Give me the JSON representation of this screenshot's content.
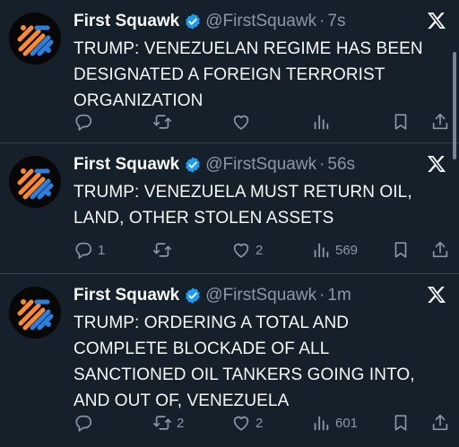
{
  "colors": {
    "background": "#15202b",
    "text": "#f7f9f9",
    "secondary": "#8b98a5",
    "verified": "#1d9bf0",
    "avatar_orange": "#f58a3a",
    "avatar_blue": "#2f7fd8"
  },
  "tweets": [
    {
      "name": "First Squawk",
      "handle": "@FirstSquawk",
      "separator": "·",
      "time": "7s",
      "text": "TRUMP: VENEZUELAN REGIME HAS BEEN DESIGNATED A FOREIGN TERRORIST ORGANIZATION",
      "replies": "",
      "retweets": "",
      "likes": "",
      "views": ""
    },
    {
      "name": "First Squawk",
      "handle": "@FirstSquawk",
      "separator": "·",
      "time": "56s",
      "text": "TRUMP: VENEZUELA MUST RETURN OIL, LAND, OTHER STOLEN ASSETS",
      "replies": "1",
      "retweets": "",
      "likes": "2",
      "views": "569"
    },
    {
      "name": "First Squawk",
      "handle": "@FirstSquawk",
      "separator": "·",
      "time": "1m",
      "text": "TRUMP: ORDERING A TOTAL AND COMPLETE BLOCKADE OF ALL SANCTIONED OIL TANKERS GOING INTO, AND OUT OF, VENEZUELA",
      "replies": "",
      "retweets": "2",
      "likes": "2",
      "views": "601"
    }
  ],
  "icons": [
    "avatar-logo",
    "verified-badge-icon",
    "x-logo-icon",
    "reply-icon",
    "retweet-icon",
    "like-icon",
    "views-icon",
    "bookmark-icon",
    "share-icon"
  ]
}
